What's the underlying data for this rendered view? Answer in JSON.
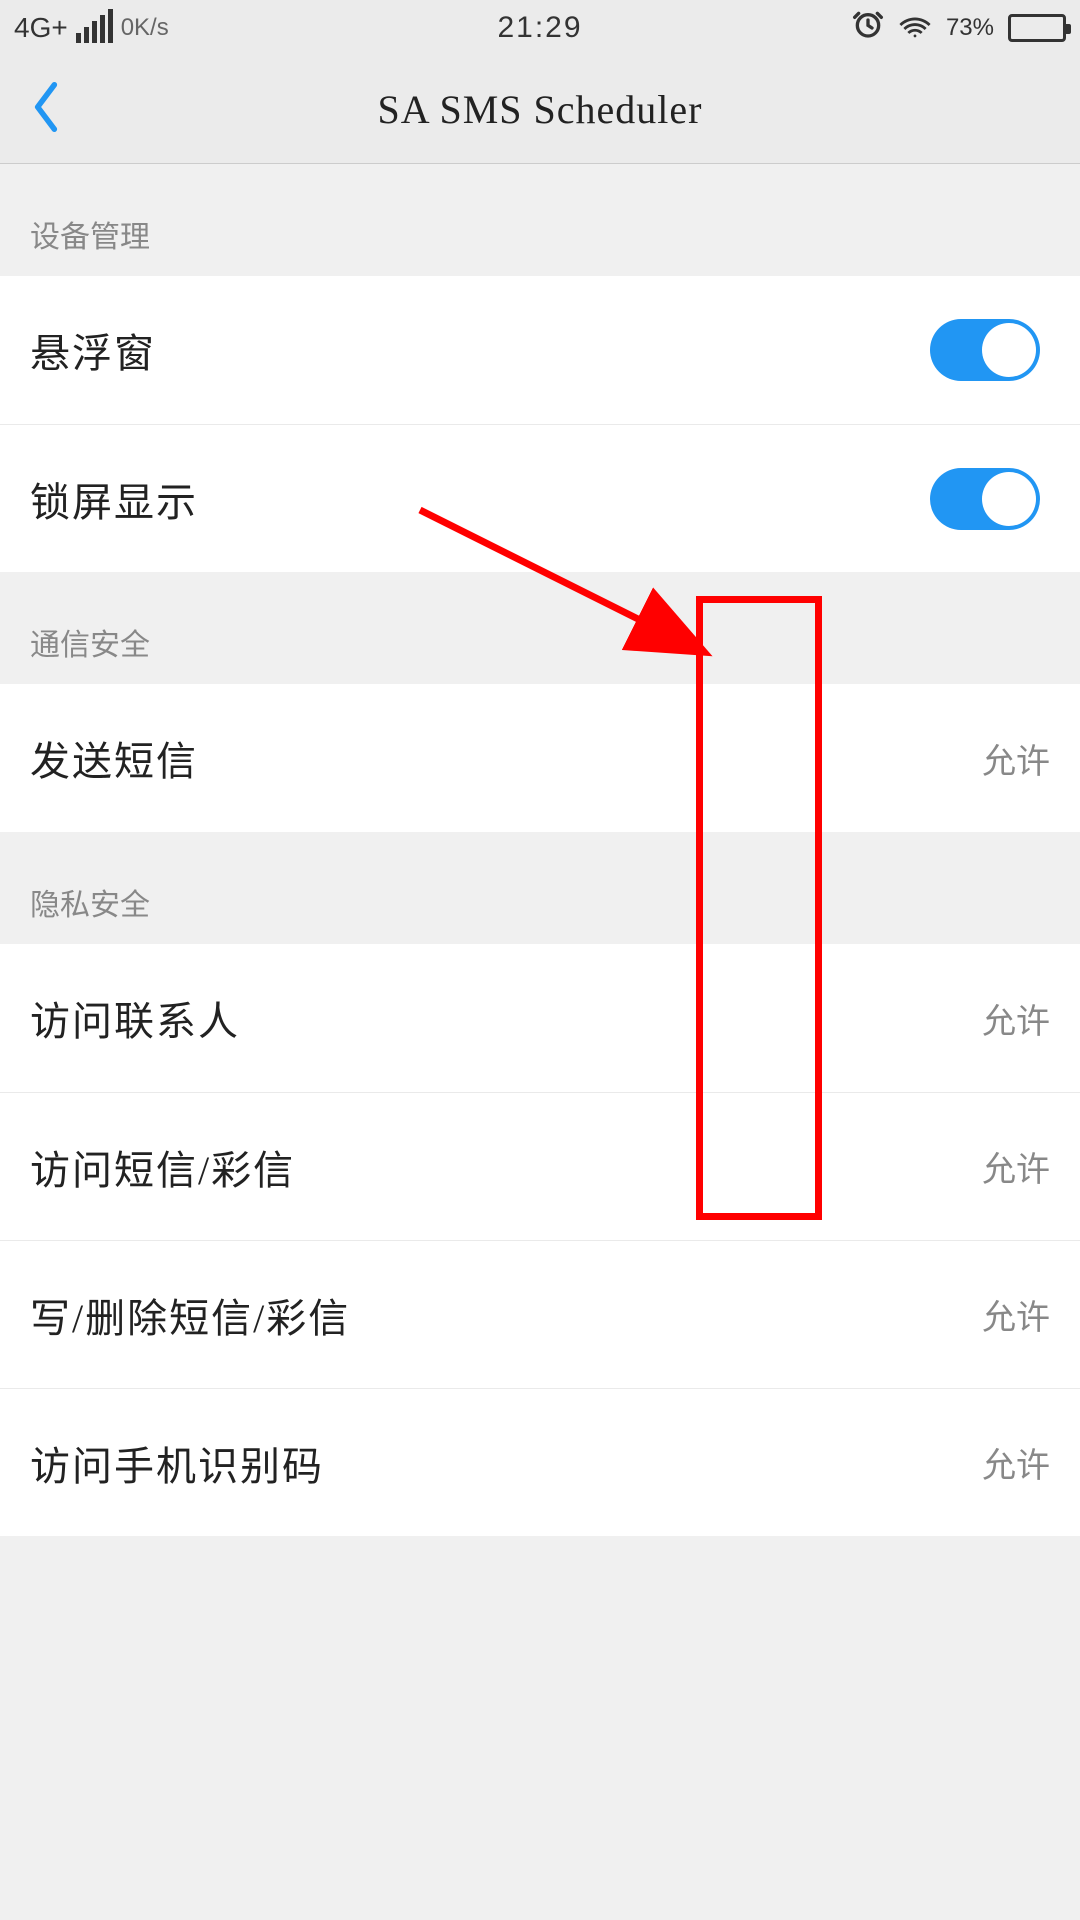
{
  "status": {
    "network": "4G+",
    "speed": "0K/s",
    "time": "21:29",
    "battery_pct": "73%"
  },
  "nav": {
    "title": "SA SMS Scheduler"
  },
  "sections": {
    "device": {
      "header": "设备管理",
      "items": [
        {
          "label": "悬浮窗",
          "toggle": true
        },
        {
          "label": "锁屏显示",
          "toggle": true
        }
      ]
    },
    "comm": {
      "header": "通信安全",
      "items": [
        {
          "label": "发送短信",
          "value": "允许"
        }
      ]
    },
    "privacy": {
      "header": "隐私安全",
      "items": [
        {
          "label": "访问联系人",
          "value": "允许"
        },
        {
          "label": "访问短信/彩信",
          "value": "允许"
        },
        {
          "label": "写/删除短信/彩信",
          "value": "允许"
        },
        {
          "label": "访问手机识别码",
          "value": "允许"
        }
      ]
    }
  }
}
